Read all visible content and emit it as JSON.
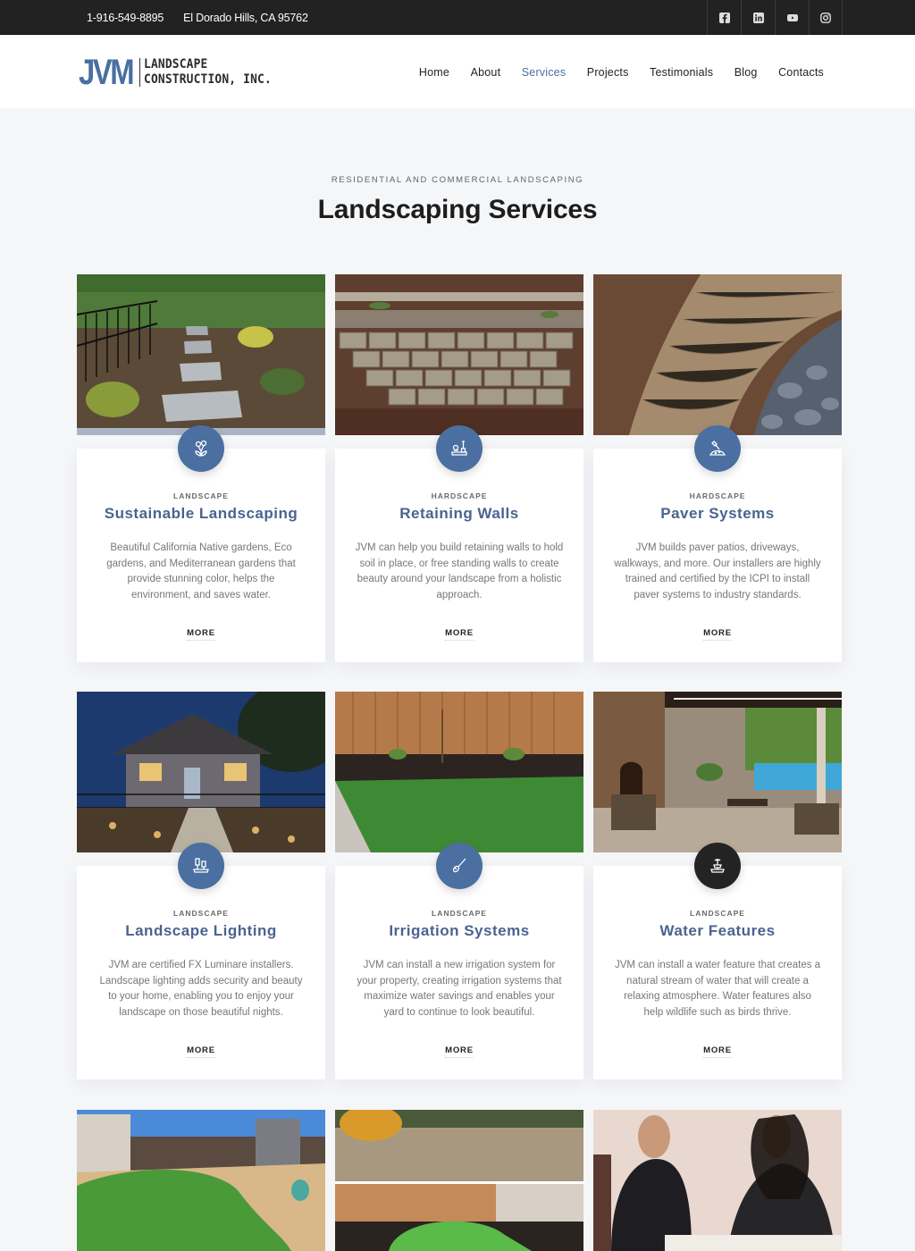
{
  "topbar": {
    "phone": "1-916-549-8895",
    "address": "El Dorado Hills, CA 95762",
    "social": [
      {
        "name": "facebook",
        "icon": "facebook-icon"
      },
      {
        "name": "linkedin",
        "icon": "linkedin-icon"
      },
      {
        "name": "youtube",
        "icon": "youtube-icon"
      },
      {
        "name": "instagram",
        "icon": "instagram-icon"
      }
    ]
  },
  "header": {
    "logo": {
      "mark": "JVM",
      "line1": "LANDSCAPE",
      "line2": "CONSTRUCTION, INC."
    },
    "nav": [
      {
        "label": "Home",
        "active": false
      },
      {
        "label": "About",
        "active": false
      },
      {
        "label": "Services",
        "active": true
      },
      {
        "label": "Projects",
        "active": false
      },
      {
        "label": "Testimonials",
        "active": false
      },
      {
        "label": "Blog",
        "active": false
      },
      {
        "label": "Contacts",
        "active": false
      }
    ]
  },
  "section": {
    "eyebrow": "RESIDENTIAL AND COMMERCIAL LANDSCAPING",
    "title": "Landscaping Services"
  },
  "colors": {
    "accent": "#4a6fa0",
    "title_blue": "#4a6390",
    "topbar_bg": "#222222",
    "page_bg": "#f5f6f8"
  },
  "services": [
    {
      "category": "LANDSCAPE",
      "title": "Sustainable Landscaping",
      "description": "Beautiful California Native gardens, Eco gardens, and Mediterranean gardens that provide stunning color, helps the environment, and saves water.",
      "more": "MORE",
      "icon": "flower-plant-icon",
      "photo": "stepping-stone-garden-path"
    },
    {
      "category": "HARDSCAPE",
      "title": "Retaining Walls",
      "description": "JVM can help you build retaining walls to hold soil in place, or free standing walls to create beauty around your landscape from a holistic approach.",
      "more": "MORE",
      "icon": "shovel-wall-icon",
      "photo": "block-retaining-wall"
    },
    {
      "category": "HARDSCAPE",
      "title": "Paver Systems",
      "description": "JVM builds paver patios, driveways, walkways, and more. Our installers are highly trained and certified by the ICPI to install paver systems to industry standards.",
      "more": "MORE",
      "icon": "trowel-pile-icon",
      "photo": "paver-patio-with-rocks"
    },
    {
      "category": "LANDSCAPE",
      "title": "Landscape Lighting",
      "description": "JVM are certified FX Luminare installers. Landscape lighting adds security and beauty to your home, enabling you to enjoy your landscape on those beautiful nights.",
      "more": "MORE",
      "icon": "garden-lights-icon",
      "photo": "house-at-night-lit"
    },
    {
      "category": "LANDSCAPE",
      "title": "Irrigation Systems",
      "description": "JVM can install a new irrigation system for your property, creating irrigation systems that maximize water savings and enables your yard to continue to look beautiful.",
      "more": "MORE",
      "icon": "sprinkler-wand-icon",
      "photo": "lawn-with-wood-fence"
    },
    {
      "category": "LANDSCAPE",
      "title": "Water Features",
      "description": "JVM can install a water feature that creates a natural stream of water that will create a relaxing atmosphere. Water features also help wildlife such as birds thrive.",
      "more": "MORE",
      "icon": "fountain-icon",
      "photo": "patio-fireplace-pool"
    }
  ],
  "bottom_photos": [
    {
      "photo": "artificial-turf-backyard"
    },
    {
      "photo": "before-after-putting-green"
    },
    {
      "photo": "consultation-couple"
    }
  ]
}
